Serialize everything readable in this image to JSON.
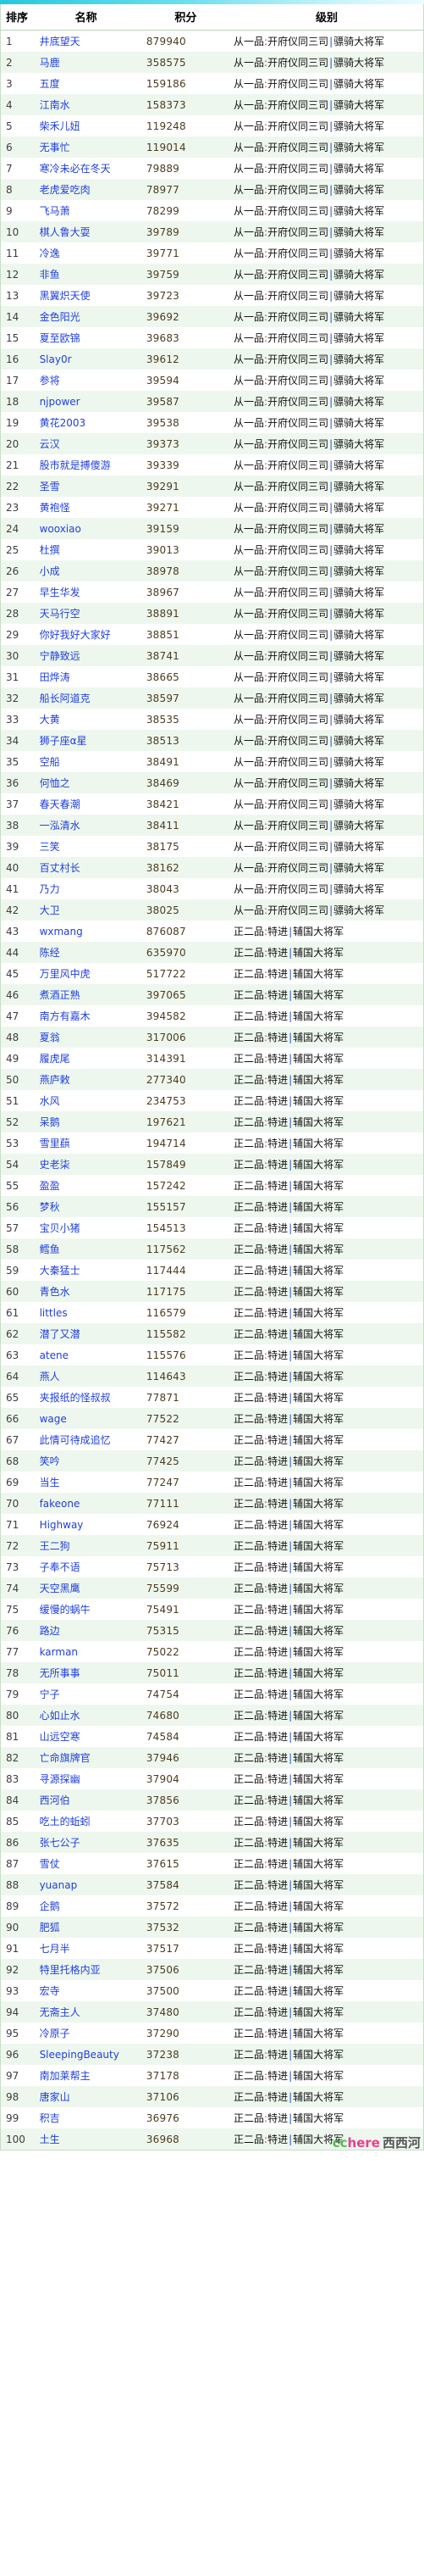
{
  "topbar": {
    "present": true
  },
  "table": {
    "columns": [
      {
        "key": "rank",
        "label": "排序"
      },
      {
        "key": "name",
        "label": "名称"
      },
      {
        "key": "score",
        "label": "积分"
      },
      {
        "key": "level",
        "label": "级别"
      }
    ],
    "levels": {
      "a": {
        "grade": "从一品",
        "colon": ":",
        "title": "开府仪同三司",
        "sep": "|",
        "military": "骠骑大将军"
      },
      "b": {
        "grade": "正二品",
        "colon": ":",
        "title": "特进",
        "sep": "|",
        "military": "辅国大将军"
      }
    },
    "rows": [
      {
        "rank": "1",
        "name": "井底望天",
        "score": "879940",
        "level": "a"
      },
      {
        "rank": "2",
        "name": "马鹿",
        "score": "358575",
        "level": "a"
      },
      {
        "rank": "3",
        "name": "五度",
        "score": "159186",
        "level": "a"
      },
      {
        "rank": "4",
        "name": "江南水",
        "score": "158373",
        "level": "a"
      },
      {
        "rank": "5",
        "name": "柴禾儿妞",
        "score": "119248",
        "level": "a"
      },
      {
        "rank": "6",
        "name": "无事忙",
        "score": "119014",
        "level": "a"
      },
      {
        "rank": "7",
        "name": "寒冷未必在冬天",
        "score": "79889",
        "level": "a"
      },
      {
        "rank": "8",
        "name": "老虎爱吃肉",
        "score": "78977",
        "level": "a"
      },
      {
        "rank": "9",
        "name": "飞马萧",
        "score": "78299",
        "level": "a"
      },
      {
        "rank": "10",
        "name": "棋人鲁大耍",
        "score": "39789",
        "level": "a"
      },
      {
        "rank": "11",
        "name": "冷逸",
        "score": "39771",
        "level": "a"
      },
      {
        "rank": "12",
        "name": "非鱼",
        "score": "39759",
        "level": "a"
      },
      {
        "rank": "13",
        "name": "黑翼炽天使",
        "score": "39723",
        "level": "a"
      },
      {
        "rank": "14",
        "name": "金色阳光",
        "score": "39692",
        "level": "a"
      },
      {
        "rank": "15",
        "name": "夏至欧锦",
        "score": "39683",
        "level": "a"
      },
      {
        "rank": "16",
        "name": "Slay0r",
        "score": "39612",
        "level": "a"
      },
      {
        "rank": "17",
        "name": "参将",
        "score": "39594",
        "level": "a"
      },
      {
        "rank": "18",
        "name": "njpower",
        "score": "39587",
        "level": "a"
      },
      {
        "rank": "19",
        "name": "黄花2003",
        "score": "39538",
        "level": "a"
      },
      {
        "rank": "20",
        "name": "云汉",
        "score": "39373",
        "level": "a"
      },
      {
        "rank": "21",
        "name": "股市就是搏傻游",
        "score": "39339",
        "level": "a"
      },
      {
        "rank": "22",
        "name": "圣雪",
        "score": "39291",
        "level": "a"
      },
      {
        "rank": "23",
        "name": "黄袍怪",
        "score": "39271",
        "level": "a"
      },
      {
        "rank": "24",
        "name": "wooxiao",
        "score": "39159",
        "level": "a"
      },
      {
        "rank": "25",
        "name": "杜撰",
        "score": "39013",
        "level": "a"
      },
      {
        "rank": "26",
        "name": "小成",
        "score": "38978",
        "level": "a"
      },
      {
        "rank": "27",
        "name": "早生华发",
        "score": "38967",
        "level": "a"
      },
      {
        "rank": "28",
        "name": "天马行空",
        "score": "38891",
        "level": "a"
      },
      {
        "rank": "29",
        "name": "你好我好大家好",
        "score": "38851",
        "level": "a"
      },
      {
        "rank": "30",
        "name": "宁静致远",
        "score": "38741",
        "level": "a"
      },
      {
        "rank": "31",
        "name": "田烨涛",
        "score": "38665",
        "level": "a"
      },
      {
        "rank": "32",
        "name": "船长阿道克",
        "score": "38597",
        "level": "a"
      },
      {
        "rank": "33",
        "name": "大黄",
        "score": "38535",
        "level": "a"
      },
      {
        "rank": "34",
        "name": "狮子座α星",
        "score": "38513",
        "level": "a"
      },
      {
        "rank": "35",
        "name": "空船",
        "score": "38491",
        "level": "a"
      },
      {
        "rank": "36",
        "name": "何恤之",
        "score": "38469",
        "level": "a"
      },
      {
        "rank": "37",
        "name": "春天春潮",
        "score": "38421",
        "level": "a"
      },
      {
        "rank": "38",
        "name": "一泓清水",
        "score": "38411",
        "level": "a"
      },
      {
        "rank": "39",
        "name": "三笑",
        "score": "38175",
        "level": "a"
      },
      {
        "rank": "40",
        "name": "百丈村长",
        "score": "38162",
        "level": "a"
      },
      {
        "rank": "41",
        "name": "乃力",
        "score": "38043",
        "level": "a"
      },
      {
        "rank": "42",
        "name": "大卫",
        "score": "38025",
        "level": "a"
      },
      {
        "rank": "43",
        "name": "wxmang",
        "score": "876087",
        "level": "b"
      },
      {
        "rank": "44",
        "name": "陈经",
        "score": "635970",
        "level": "b"
      },
      {
        "rank": "45",
        "name": "万里风中虎",
        "score": "517722",
        "level": "b"
      },
      {
        "rank": "46",
        "name": "煮酒正熟",
        "score": "397065",
        "level": "b"
      },
      {
        "rank": "47",
        "name": "南方有嘉木",
        "score": "394582",
        "level": "b"
      },
      {
        "rank": "48",
        "name": "夏翁",
        "score": "317006",
        "level": "b"
      },
      {
        "rank": "49",
        "name": "履虎尾",
        "score": "314391",
        "level": "b"
      },
      {
        "rank": "50",
        "name": "燕庐敕",
        "score": "277340",
        "level": "b"
      },
      {
        "rank": "51",
        "name": "水风",
        "score": "234753",
        "level": "b"
      },
      {
        "rank": "52",
        "name": "呆鹅",
        "score": "197621",
        "level": "b"
      },
      {
        "rank": "53",
        "name": "雪里蕻",
        "score": "194714",
        "level": "b"
      },
      {
        "rank": "54",
        "name": "史老柒",
        "score": "157849",
        "level": "b"
      },
      {
        "rank": "55",
        "name": "盈盈",
        "score": "157242",
        "level": "b"
      },
      {
        "rank": "56",
        "name": "梦秋",
        "score": "155157",
        "level": "b"
      },
      {
        "rank": "57",
        "name": "宝贝小猪",
        "score": "154513",
        "level": "b"
      },
      {
        "rank": "58",
        "name": "鳕鱼",
        "score": "117562",
        "level": "b"
      },
      {
        "rank": "59",
        "name": "大秦猛士",
        "score": "117444",
        "level": "b"
      },
      {
        "rank": "60",
        "name": "青色水",
        "score": "117175",
        "level": "b"
      },
      {
        "rank": "61",
        "name": "littles",
        "score": "116579",
        "level": "b"
      },
      {
        "rank": "62",
        "name": "潜了又潜",
        "score": "115582",
        "level": "b"
      },
      {
        "rank": "63",
        "name": "atene",
        "score": "115576",
        "level": "b"
      },
      {
        "rank": "64",
        "name": "燕人",
        "score": "114643",
        "level": "b"
      },
      {
        "rank": "65",
        "name": "夹报纸的怪叔叔",
        "score": "77871",
        "level": "b"
      },
      {
        "rank": "66",
        "name": "wage",
        "score": "77522",
        "level": "b"
      },
      {
        "rank": "67",
        "name": "此情可待成追忆",
        "score": "77427",
        "level": "b"
      },
      {
        "rank": "68",
        "name": "笑吟",
        "score": "77425",
        "level": "b"
      },
      {
        "rank": "69",
        "name": "当生",
        "score": "77247",
        "level": "b"
      },
      {
        "rank": "70",
        "name": "fakeone",
        "score": "77111",
        "level": "b"
      },
      {
        "rank": "71",
        "name": "Highway",
        "score": "76924",
        "level": "b"
      },
      {
        "rank": "72",
        "name": "王二狗",
        "score": "75911",
        "level": "b"
      },
      {
        "rank": "73",
        "name": "子奉不语",
        "score": "75713",
        "level": "b"
      },
      {
        "rank": "74",
        "name": "天空黑鹰",
        "score": "75599",
        "level": "b"
      },
      {
        "rank": "75",
        "name": "缓慢的蜗牛",
        "score": "75491",
        "level": "b"
      },
      {
        "rank": "76",
        "name": "路边",
        "score": "75315",
        "level": "b"
      },
      {
        "rank": "77",
        "name": "karman",
        "score": "75022",
        "level": "b"
      },
      {
        "rank": "78",
        "name": "无所事事",
        "score": "75011",
        "level": "b"
      },
      {
        "rank": "79",
        "name": "宁子",
        "score": "74754",
        "level": "b"
      },
      {
        "rank": "80",
        "name": "心如止水",
        "score": "74680",
        "level": "b"
      },
      {
        "rank": "81",
        "name": "山远空寒",
        "score": "74584",
        "level": "b"
      },
      {
        "rank": "82",
        "name": "亡命旗牌官",
        "score": "37946",
        "level": "b"
      },
      {
        "rank": "83",
        "name": "寻源探幽",
        "score": "37904",
        "level": "b"
      },
      {
        "rank": "84",
        "name": "西河伯",
        "score": "37856",
        "level": "b"
      },
      {
        "rank": "85",
        "name": "吃土的蚯蚓",
        "score": "37703",
        "level": "b"
      },
      {
        "rank": "86",
        "name": "张七公子",
        "score": "37635",
        "level": "b"
      },
      {
        "rank": "87",
        "name": "雪仗",
        "score": "37615",
        "level": "b"
      },
      {
        "rank": "88",
        "name": "yuanap",
        "score": "37584",
        "level": "b"
      },
      {
        "rank": "89",
        "name": "企鹅",
        "score": "37572",
        "level": "b"
      },
      {
        "rank": "90",
        "name": "肥狐",
        "score": "37532",
        "level": "b"
      },
      {
        "rank": "91",
        "name": "七月半",
        "score": "37517",
        "level": "b"
      },
      {
        "rank": "92",
        "name": "特里托格内亚",
        "score": "37506",
        "level": "b"
      },
      {
        "rank": "93",
        "name": "宏寺",
        "score": "37500",
        "level": "b"
      },
      {
        "rank": "94",
        "name": "无斋主人",
        "score": "37480",
        "level": "b"
      },
      {
        "rank": "95",
        "name": "冷原子",
        "score": "37290",
        "level": "b"
      },
      {
        "rank": "96",
        "name": "SleepingBeauty",
        "score": "37238",
        "level": "b"
      },
      {
        "rank": "97",
        "name": "南加莱帮主",
        "score": "37178",
        "level": "b"
      },
      {
        "rank": "98",
        "name": "唐家山",
        "score": "37106",
        "level": "b"
      },
      {
        "rank": "99",
        "name": "积吉",
        "score": "36976",
        "level": "b"
      },
      {
        "rank": "100",
        "name": "土生",
        "score": "36968",
        "level": "b"
      }
    ]
  },
  "watermark": {
    "cc": "cc",
    "here": "here",
    "site": "西西河"
  },
  "colors": {
    "link": "#1f3fdd",
    "score": "#4a3c20",
    "row_alt": "#eef7ee",
    "topbar": "#25c8e0",
    "accent_colon": "#c03a2b",
    "separator": "#2255cc"
  }
}
